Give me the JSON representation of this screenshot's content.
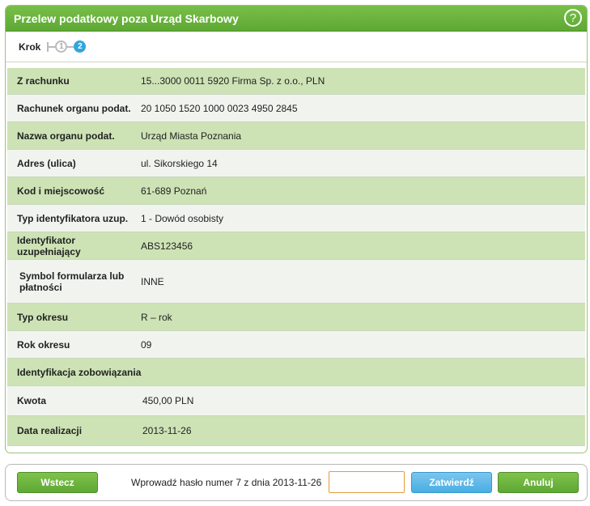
{
  "header": {
    "title": "Przelew podatkowy poza Urząd Skarbowy",
    "help_glyph": "?"
  },
  "steps": {
    "label": "Krok",
    "step1": "1",
    "step2": "2",
    "active": 2
  },
  "rows": [
    {
      "label": "Z rachunku",
      "value": "15...3000 0011 5920 Firma Sp. z o.o., PLN"
    },
    {
      "label": "Rachunek organu podat.",
      "value": "20 1050 1520 1000 0023 4950 2845"
    },
    {
      "label": "Nazwa organu podat.",
      "value": "Urząd Miasta Poznania"
    },
    {
      "label": "Adres (ulica)",
      "value": "ul. Sikorskiego 14"
    },
    {
      "label": "Kod i miejscowość",
      "value": "61-689 Poznań"
    },
    {
      "label": "Typ identyfikatora uzup.",
      "value": "1 - Dowód osobisty"
    },
    {
      "label": "Identyfikator uzupełniający",
      "value": "ABS123456"
    },
    {
      "label": "Symbol formularza lub płatności",
      "value": "INNE"
    },
    {
      "label": "Typ okresu",
      "value": "R – rok"
    },
    {
      "label": "Rok okresu",
      "value": "09"
    },
    {
      "label": "Identyfikacja zobowiązania",
      "value": ""
    },
    {
      "label": "Kwota",
      "value": "450,00  PLN"
    },
    {
      "label": "Data realizacji",
      "value": "2013-11-26"
    }
  ],
  "footer": {
    "back_label": "Wstecz",
    "prompt": "Wprowadź hasło numer 7 z dnia 2013-11-26",
    "password_value": "",
    "confirm_label": "Zatwierdź",
    "cancel_label": "Anuluj"
  },
  "colors": {
    "accent_green": "#5ea834",
    "row_green": "#cde3b5",
    "row_light": "#f1f4ee",
    "confirm_blue": "#48aee3"
  }
}
